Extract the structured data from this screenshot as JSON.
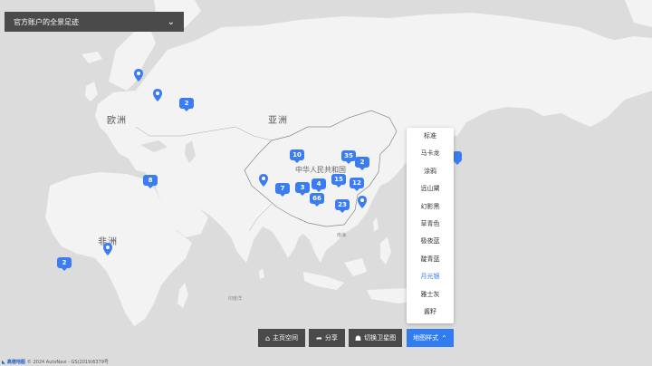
{
  "panel": {
    "title": "官方账户的全景足迹"
  },
  "regions": {
    "europe": "欧洲",
    "asia": "亚洲",
    "africa": "非洲",
    "china": "中华人民共和国"
  },
  "clusters": [
    {
      "name": "cluster-russia",
      "count": "2"
    },
    {
      "name": "cluster-middle-east",
      "count": "8"
    },
    {
      "name": "cluster-west-africa",
      "count": "2"
    },
    {
      "name": "cluster-xinjiang",
      "count": "10"
    },
    {
      "name": "cluster-north-china",
      "count": "35"
    },
    {
      "name": "cluster-northeast",
      "count": "2"
    },
    {
      "name": "cluster-tibet",
      "count": "7"
    },
    {
      "name": "cluster-qinghai",
      "count": "3"
    },
    {
      "name": "cluster-sichuan",
      "count": "4"
    },
    {
      "name": "cluster-chongqing",
      "count": "66"
    },
    {
      "name": "cluster-henan",
      "count": "15"
    },
    {
      "name": "cluster-jiangsu",
      "count": "12"
    },
    {
      "name": "cluster-south-china",
      "count": "23"
    }
  ],
  "style_menu": {
    "items": [
      "标准",
      "马卡龙",
      "涂鸦",
      "远山黛",
      "幻影黑",
      "草青色",
      "极夜蓝",
      "靛青蓝",
      "月光银",
      "雅士灰",
      "酱籽"
    ],
    "selected": "月光银"
  },
  "toolbar": {
    "home_label": "主页空间",
    "share_label": "分享",
    "satellite_label": "切换卫星图",
    "map_style_label": "地图样式"
  },
  "footer": {
    "brand": "高德地图",
    "copyright": "© 2024 AutoNavi - GS(2019)6379号"
  },
  "minor_labels": {
    "ocean_south": "南海",
    "ocean_indian": "印度洋"
  },
  "colors": {
    "land": "#f3f3f3",
    "water": "#dcdcdc",
    "accent": "#3b7df0",
    "panel": "#4a4a4a"
  }
}
